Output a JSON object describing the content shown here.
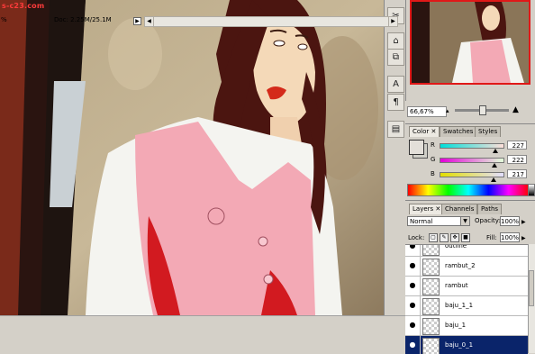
{
  "canvas": {
    "watermark": "s-c23.com"
  },
  "status": {
    "zoom": "%",
    "doc": "Doc: 2.25M/25.1M"
  },
  "navigator": {
    "zoom": "66,67%"
  },
  "color": {
    "tabs": [
      "Color",
      "Swatches",
      "Styles"
    ],
    "channels": [
      {
        "label": "R",
        "value": "227",
        "level": 0.89,
        "gradient": "linear-gradient(90deg,#00dfd9,#ffdfd9)"
      },
      {
        "label": "G",
        "value": "222",
        "level": 0.87,
        "gradient": "linear-gradient(90deg,#e300d9,#e3ffd9)"
      },
      {
        "label": "B",
        "value": "217",
        "level": 0.85,
        "gradient": "linear-gradient(90deg,#e3df00,#e3dfff)"
      }
    ],
    "foreground": "#e3dfd9"
  },
  "layers": {
    "tabs": [
      "Layers",
      "Channels",
      "Paths"
    ],
    "blend_mode": "Normal",
    "opacity_label": "Opacity:",
    "opacity": "100%",
    "lock_label": "Lock:",
    "fill_label": "Fill:",
    "fill": "100%",
    "items": [
      {
        "name": "outline",
        "selected": false
      },
      {
        "name": "rambut_2",
        "selected": false
      },
      {
        "name": "rambut",
        "selected": false
      },
      {
        "name": "baju_1_1",
        "selected": false
      },
      {
        "name": "baju_1",
        "selected": false
      },
      {
        "name": "baju_0_1",
        "selected": true
      }
    ]
  },
  "colors": {
    "selection": "#0a246a",
    "accent": "#e01818"
  }
}
